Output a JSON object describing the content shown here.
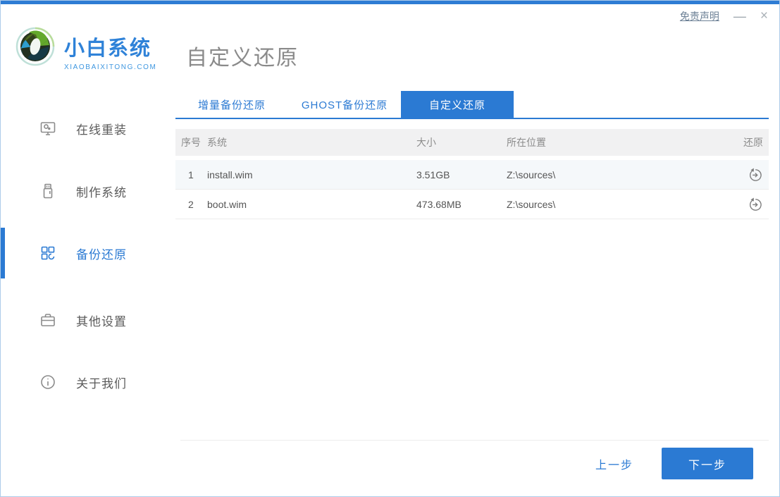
{
  "window_controls": {
    "disclaimer_label": "免责声明",
    "minimize_label": "—",
    "close_label": "×"
  },
  "brand": {
    "name": "小白系统",
    "domain": "XIAOBAIXITONG.COM"
  },
  "page_title": "自定义还原",
  "sidebar": {
    "items": [
      {
        "label": "在线重装",
        "icon": "monitor-icon",
        "active": false
      },
      {
        "label": "制作系统",
        "icon": "usb-drive-icon",
        "active": false
      },
      {
        "label": "备份还原",
        "icon": "grid-blocks-icon",
        "active": true
      },
      {
        "label": "其他设置",
        "icon": "toolbox-icon",
        "active": false
      },
      {
        "label": "关于我们",
        "icon": "info-circle-icon",
        "active": false
      }
    ]
  },
  "tabs": [
    {
      "label": "增量备份还原",
      "active": false
    },
    {
      "label": "GHOST备份还原",
      "active": false
    },
    {
      "label": "自定义还原",
      "active": true
    }
  ],
  "table": {
    "headers": {
      "no": "序号",
      "system": "系统",
      "size": "大小",
      "location": "所在位置",
      "restore": "还原"
    },
    "rows": [
      {
        "no": "1",
        "system": "install.wim",
        "size": "3.51GB",
        "location": "Z:\\sources\\",
        "action_icon": "restore-icon"
      },
      {
        "no": "2",
        "system": "boot.wim",
        "size": "473.68MB",
        "location": "Z:\\sources\\",
        "action_icon": "restore-icon"
      }
    ]
  },
  "footer": {
    "prev_label": "上一步",
    "next_label": "下一步"
  },
  "colors": {
    "primary_blue": "#2b7ad3",
    "topbar_blue": "#2e7cd4",
    "window_border": "#aecbea",
    "title_gray": "#8a8a8a",
    "row_alt_bg": "#f5f8fa",
    "table_header_bg": "#f1f1f2"
  }
}
